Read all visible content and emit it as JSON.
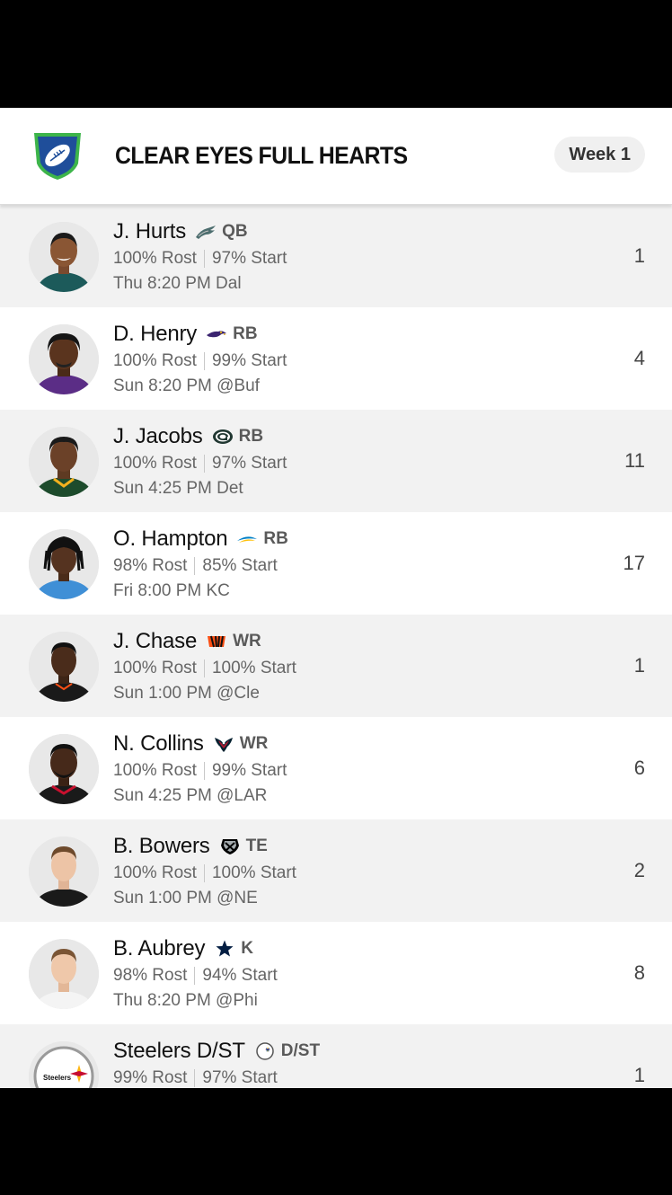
{
  "team": {
    "name": "CLEAR EYES FULL HEARTS",
    "week": "Week 1"
  },
  "players": [
    {
      "name": "J. Hurts",
      "team_icon": "eagles-icon",
      "position": "QB",
      "rost": "100% Rost",
      "start": "97% Start",
      "game": "Thu 8:20 PM Dal",
      "rank": "1"
    },
    {
      "name": "D. Henry",
      "team_icon": "ravens-icon",
      "position": "RB",
      "rost": "100% Rost",
      "start": "99% Start",
      "game": "Sun 8:20 PM @Buf",
      "rank": "4"
    },
    {
      "name": "J. Jacobs",
      "team_icon": "packers-icon",
      "position": "RB",
      "rost": "100% Rost",
      "start": "97% Start",
      "game": "Sun 4:25 PM Det",
      "rank": "11"
    },
    {
      "name": "O. Hampton",
      "team_icon": "chargers-icon",
      "position": "RB",
      "rost": "98% Rost",
      "start": "85% Start",
      "game": "Fri 8:00 PM KC",
      "rank": "17"
    },
    {
      "name": "J. Chase",
      "team_icon": "bengals-icon",
      "position": "WR",
      "rost": "100% Rost",
      "start": "100% Start",
      "game": "Sun 1:00 PM @Cle",
      "rank": "1"
    },
    {
      "name": "N. Collins",
      "team_icon": "texans-icon",
      "position": "WR",
      "rost": "100% Rost",
      "start": "99% Start",
      "game": "Sun 4:25 PM @LAR",
      "rank": "6"
    },
    {
      "name": "B. Bowers",
      "team_icon": "raiders-icon",
      "position": "TE",
      "rost": "100% Rost",
      "start": "100% Start",
      "game": "Sun 1:00 PM @NE",
      "rank": "2"
    },
    {
      "name": "B. Aubrey",
      "team_icon": "cowboys-icon",
      "position": "K",
      "rost": "98% Rost",
      "start": "94% Start",
      "game": "Thu 8:20 PM @Phi",
      "rank": "8"
    },
    {
      "name": "Steelers D/ST",
      "team_icon": "steelers-icon",
      "position": "D/ST",
      "rost": "99% Rost",
      "start": "97% Start",
      "game": "",
      "rank": "1",
      "avatar_text": "Steelers"
    }
  ]
}
